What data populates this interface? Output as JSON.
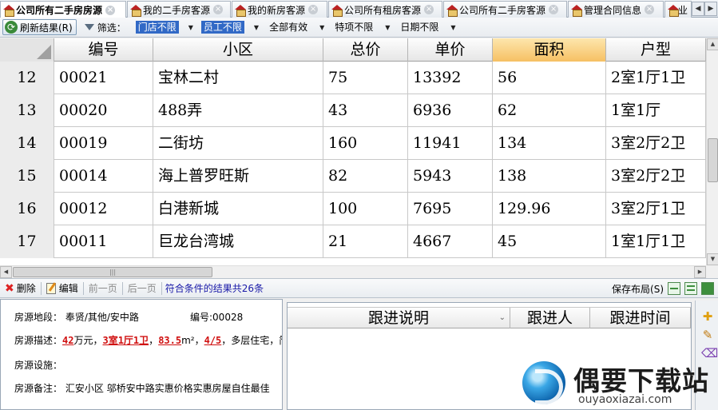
{
  "tabs": [
    {
      "label": "公司所有二手房房源",
      "active": true
    },
    {
      "label": "我的二手房客源",
      "active": false
    },
    {
      "label": "我的新房客源",
      "active": false
    },
    {
      "label": "公司所有租房客源",
      "active": false
    },
    {
      "label": "公司所有二手房客源",
      "active": false
    },
    {
      "label": "管理合同信息",
      "active": false
    },
    {
      "label": "业",
      "active": false
    }
  ],
  "toolbar": {
    "refresh_label": "刷新结果(R)",
    "filter_label": "筛选：",
    "store_filter": "门店不限",
    "staff_filter": "员工不限",
    "valid_filter": "全部有效",
    "special_filter": "特项不限",
    "date_filter": "日期不限"
  },
  "grid": {
    "columns": [
      "编号",
      "小区",
      "总价",
      "单价",
      "面积",
      "户型"
    ],
    "sorted_column": "面积",
    "rows": [
      {
        "num": "12",
        "cells": [
          "00021",
          "宝林二村",
          "75",
          "13392",
          "56",
          "2室1厅1卫"
        ]
      },
      {
        "num": "13",
        "cells": [
          "00020",
          "488弄",
          "43",
          "6936",
          "62",
          "1室1厅"
        ]
      },
      {
        "num": "14",
        "cells": [
          "00019",
          "二街坊",
          "160",
          "11941",
          "134",
          "3室2厅2卫"
        ]
      },
      {
        "num": "15",
        "cells": [
          "00014",
          "海上普罗旺斯",
          "82",
          "5943",
          "138",
          "3室2厅2卫"
        ]
      },
      {
        "num": "16",
        "cells": [
          "00012",
          "白港新城",
          "100",
          "7695",
          "129.96",
          "3室2厅1卫"
        ]
      },
      {
        "num": "17",
        "cells": [
          "00011",
          "巨龙台湾城",
          "21",
          "4667",
          "45",
          "1室1厅1卫"
        ]
      }
    ]
  },
  "actionbar": {
    "delete_label": "删除",
    "edit_label": "编辑",
    "prev_label": "前一页",
    "next_label": "后一页",
    "result_text": "符合条件的结果共26条",
    "save_layout_label": "保存布局(S)"
  },
  "details": {
    "location_label": "房源地段：",
    "location_value": "奉贤/其他/安中路",
    "id_label": "编号:",
    "id_value": "00028",
    "desc_label": "房源描述：",
    "desc_price": "42",
    "desc_price_unit": "万元，",
    "desc_layout": "3室1厅1卫",
    "desc_sep1": "，",
    "desc_area": "83.5",
    "desc_area_unit": "m²，",
    "desc_floor": "4/5",
    "desc_rest": "，多层住宅，简单",
    "facility_label": "房源设施：",
    "facility_value": "",
    "remark_label": "房源备注：",
    "remark_value": "汇安小区   邬桥安中路实惠价格实惠房屋自住最佳"
  },
  "followup": {
    "columns": [
      "跟进说明",
      "跟进人",
      "跟进时间"
    ]
  },
  "watermark": {
    "title": "偶要下载站",
    "url": "ouyaoxiazai.com"
  }
}
